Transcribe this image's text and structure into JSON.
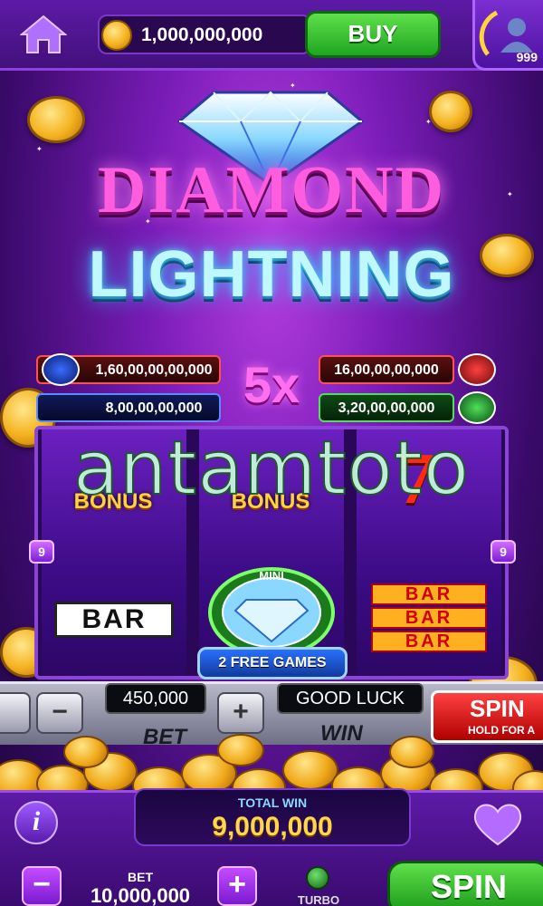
{
  "header": {
    "coin_balance": "1,000,000,000",
    "buy_label": "BUY",
    "player_level": "999"
  },
  "logo": {
    "line1": "DIAMOND",
    "line2": "LIGHTNING"
  },
  "jackpots": {
    "left_top": "1,60,00,00,00,000",
    "left_bottom": "8,00,00,00,000",
    "right_top": "16,00,00,00,000",
    "right_bottom": "3,20,00,00,000",
    "multiplier": "5x"
  },
  "reels": {
    "bonus_label": "BONUS",
    "bar_label": "BAR",
    "seven_label": "7",
    "mini_label": "MINI",
    "payline_left": "9",
    "payline_right": "9",
    "free_games": "2 FREE GAMES"
  },
  "watermark": "antamtoto",
  "machine_panel": {
    "bet_display": "450,000",
    "message_display": "GOOD LUCK",
    "bet_label": "BET",
    "win_label": "WIN",
    "minus_symbol": "−",
    "plus_symbol": "+",
    "spin_label": "SPIN",
    "spin_sub": "HOLD FOR A"
  },
  "bottom_bar": {
    "info_symbol": "i",
    "total_win_label": "TOTAL WIN",
    "total_win_value": "9,000,000",
    "bet_label": "BET",
    "bet_value": "10,000,000",
    "minus_symbol": "−",
    "plus_symbol": "+",
    "turbo_label": "TURBO",
    "spin_label": "SPIN"
  },
  "colors": {
    "accent_purple": "#7a1cb8",
    "buy_green": "#1fa620",
    "gold": "#f4b21f",
    "logo_pink": "#ff5de0",
    "logo_cyan": "#bff8ff"
  }
}
